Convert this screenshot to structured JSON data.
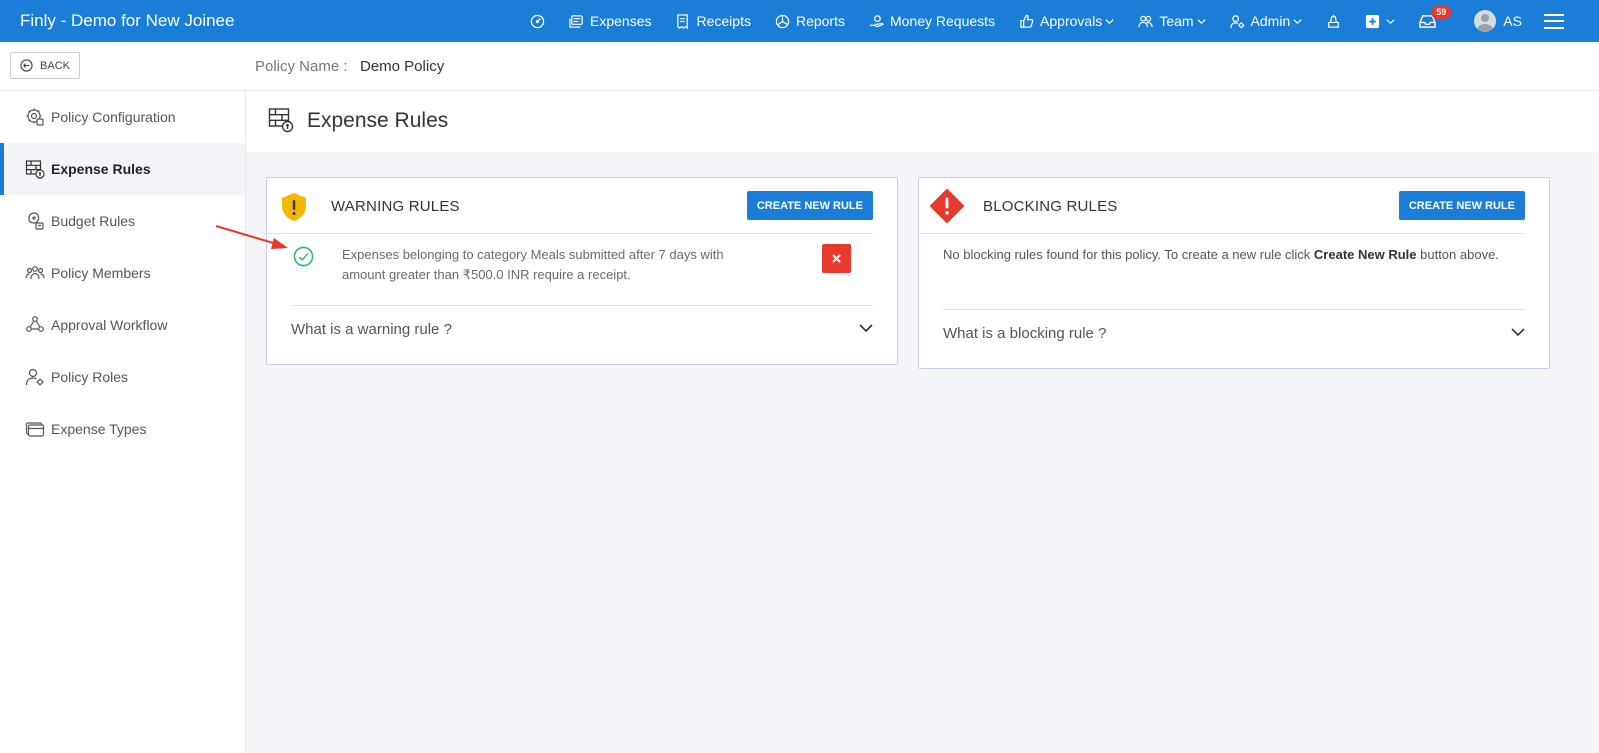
{
  "app": {
    "title": "Finly - Demo for New Joinee"
  },
  "nav": {
    "dashboard_icon": "dashboard-icon",
    "items": [
      {
        "label": "Expenses",
        "icon": "expenses-icon"
      },
      {
        "label": "Receipts",
        "icon": "receipts-icon"
      },
      {
        "label": "Reports",
        "icon": "reports-icon"
      },
      {
        "label": "Money Requests",
        "icon": "money-requests-icon"
      },
      {
        "label": "Approvals",
        "icon": "approvals-icon"
      },
      {
        "label": "Team",
        "icon": "team-icon"
      },
      {
        "label": "Admin",
        "icon": "admin-icon"
      }
    ],
    "inbox_count": "59",
    "user_initials": "AS"
  },
  "subheader": {
    "back_label": "BACK",
    "policy_label": "Policy Name :",
    "policy_name": "Demo Policy"
  },
  "sidebar": {
    "items": [
      {
        "label": "Policy Configuration",
        "icon": "policy-configuration-icon",
        "active": false
      },
      {
        "label": "Expense Rules",
        "icon": "expense-rules-icon",
        "active": true
      },
      {
        "label": "Budget Rules",
        "icon": "budget-rules-icon",
        "active": false
      },
      {
        "label": "Policy Members",
        "icon": "policy-members-icon",
        "active": false
      },
      {
        "label": "Approval Workflow",
        "icon": "approval-workflow-icon",
        "active": false
      },
      {
        "label": "Policy Roles",
        "icon": "policy-roles-icon",
        "active": false
      },
      {
        "label": "Expense Types",
        "icon": "expense-types-icon",
        "active": false
      }
    ]
  },
  "page": {
    "title": "Expense Rules"
  },
  "warning_rules": {
    "title": "WARNING RULES",
    "create_label": "CREATE NEW RULE",
    "rules": [
      {
        "text": "Expenses belonging to category Meals submitted after 7 days with amount greater than ₹500.0 INR require a receipt."
      }
    ],
    "accordion_label": "What is a warning rule ?"
  },
  "blocking_rules": {
    "title": "BLOCKING RULES",
    "create_label": "CREATE NEW RULE",
    "empty_prefix": "No blocking rules found for this policy. To create a new rule click ",
    "empty_bold": "Create New Rule",
    "empty_suffix": " button above.",
    "accordion_label": "What is a blocking rule ?"
  },
  "colors": {
    "primary": "#1a7ed8",
    "danger": "#e8392e",
    "warning": "#f5b800",
    "success": "#2eb872"
  }
}
